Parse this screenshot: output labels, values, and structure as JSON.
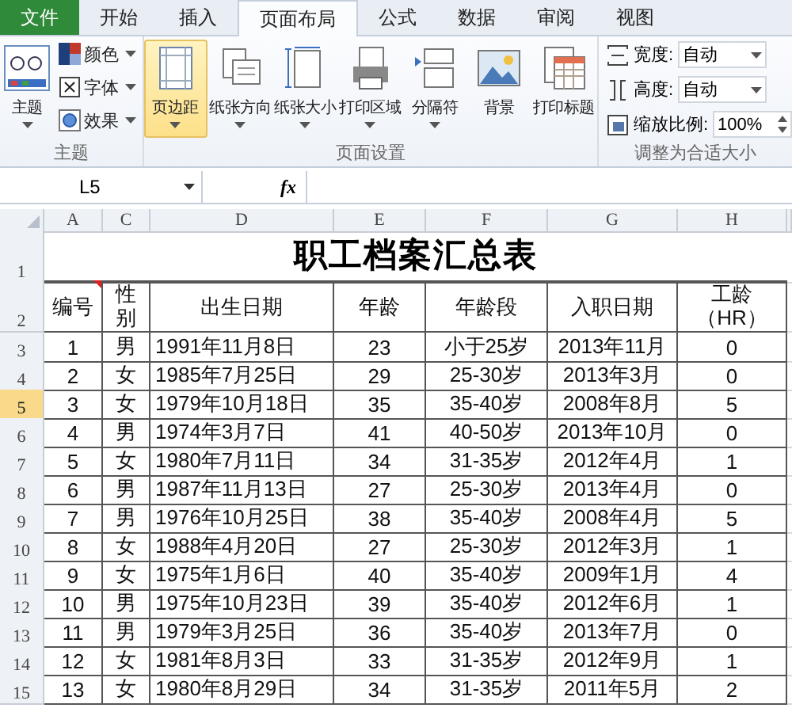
{
  "tabs": [
    {
      "label": "文件",
      "kind": "file",
      "selected": false
    },
    {
      "label": "开始",
      "kind": "tab",
      "selected": false
    },
    {
      "label": "插入",
      "kind": "tab",
      "selected": false
    },
    {
      "label": "页面布局",
      "kind": "tab",
      "selected": true
    },
    {
      "label": "公式",
      "kind": "tab",
      "selected": false
    },
    {
      "label": "数据",
      "kind": "tab",
      "selected": false
    },
    {
      "label": "审阅",
      "kind": "tab",
      "selected": false
    },
    {
      "label": "视图",
      "kind": "tab",
      "selected": false
    }
  ],
  "ribbon": {
    "theme_group": {
      "label": "主题",
      "main_button": "主题",
      "items": [
        "颜色",
        "字体",
        "效果"
      ]
    },
    "page_setup_group": {
      "label": "页面设置",
      "buttons": [
        {
          "label": "页边距",
          "selected": true,
          "dropdown": true
        },
        {
          "label": "纸张方向",
          "selected": false,
          "dropdown": true
        },
        {
          "label": "纸张大小",
          "selected": false,
          "dropdown": true
        },
        {
          "label": "打印区域",
          "selected": false,
          "dropdown": true
        },
        {
          "label": "分隔符",
          "selected": false,
          "dropdown": true
        },
        {
          "label": "背景",
          "selected": false,
          "dropdown": false
        },
        {
          "label": "打印标题",
          "selected": false,
          "dropdown": false
        }
      ]
    },
    "scale_group": {
      "label": "调整为合适大小",
      "fields": [
        {
          "label": "宽度:",
          "value": "自动",
          "kind": "dropdown"
        },
        {
          "label": "高度:",
          "value": "自动",
          "kind": "dropdown"
        },
        {
          "label": "缩放比例:",
          "value": "100%",
          "kind": "spinner"
        }
      ]
    }
  },
  "formula_bar": {
    "name_box": "L5",
    "fx": "fx"
  },
  "sheet": {
    "columns": [
      {
        "label": "A",
        "selected": false
      },
      {
        "label": "C",
        "selected": false
      },
      {
        "label": "D",
        "selected": false
      },
      {
        "label": "E",
        "selected": false
      },
      {
        "label": "F",
        "selected": false
      },
      {
        "label": "G",
        "selected": false
      },
      {
        "label": "H",
        "selected": false
      }
    ],
    "title_row": {
      "number": "1",
      "selected": false,
      "title": "职工档案汇总表"
    },
    "header_row": {
      "number": "2",
      "selected": false,
      "cells": [
        {
          "text": "编号",
          "comment": true
        },
        {
          "text": "性别",
          "comment": false
        },
        {
          "text": "出生日期",
          "comment": false
        },
        {
          "text": "年龄",
          "comment": false
        },
        {
          "text": "年龄段",
          "comment": false
        },
        {
          "text": "入职日期",
          "comment": false
        },
        {
          "text": "工龄（HR）",
          "comment": false
        }
      ]
    },
    "rows": [
      {
        "number": "3",
        "selected": false,
        "cells": [
          "1",
          "男",
          "1991年11月8日",
          "23",
          "小于25岁",
          "2013年11月",
          "0"
        ]
      },
      {
        "number": "4",
        "selected": false,
        "cells": [
          "2",
          "女",
          "1985年7月25日",
          "29",
          "25-30岁",
          "2013年3月",
          "0"
        ]
      },
      {
        "number": "5",
        "selected": true,
        "cells": [
          "3",
          "女",
          "1979年10月18日",
          "35",
          "35-40岁",
          "2008年8月",
          "5"
        ]
      },
      {
        "number": "6",
        "selected": false,
        "cells": [
          "4",
          "男",
          "1974年3月7日",
          "41",
          "40-50岁",
          "2013年10月",
          "0"
        ]
      },
      {
        "number": "7",
        "selected": false,
        "cells": [
          "5",
          "女",
          "1980年7月11日",
          "34",
          "31-35岁",
          "2012年4月",
          "1"
        ]
      },
      {
        "number": "8",
        "selected": false,
        "cells": [
          "6",
          "男",
          "1987年11月13日",
          "27",
          "25-30岁",
          "2013年4月",
          "0"
        ]
      },
      {
        "number": "9",
        "selected": false,
        "cells": [
          "7",
          "男",
          "1976年10月25日",
          "38",
          "35-40岁",
          "2008年4月",
          "5"
        ]
      },
      {
        "number": "10",
        "selected": false,
        "cells": [
          "8",
          "女",
          "1988年4月20日",
          "27",
          "25-30岁",
          "2012年3月",
          "1"
        ]
      },
      {
        "number": "11",
        "selected": false,
        "cells": [
          "9",
          "女",
          "1975年1月6日",
          "40",
          "35-40岁",
          "2009年1月",
          "4"
        ]
      },
      {
        "number": "12",
        "selected": false,
        "cells": [
          "10",
          "男",
          "1975年10月23日",
          "39",
          "35-40岁",
          "2012年6月",
          "1"
        ]
      },
      {
        "number": "13",
        "selected": false,
        "cells": [
          "11",
          "男",
          "1979年3月25日",
          "36",
          "35-40岁",
          "2013年7月",
          "0"
        ]
      },
      {
        "number": "14",
        "selected": false,
        "cells": [
          "12",
          "女",
          "1981年8月3日",
          "33",
          "31-35岁",
          "2012年9月",
          "1"
        ]
      },
      {
        "number": "15",
        "selected": false,
        "cells": [
          "13",
          "女",
          "1980年8月29日",
          "34",
          "31-35岁",
          "2011年5月",
          "2"
        ]
      }
    ]
  }
}
